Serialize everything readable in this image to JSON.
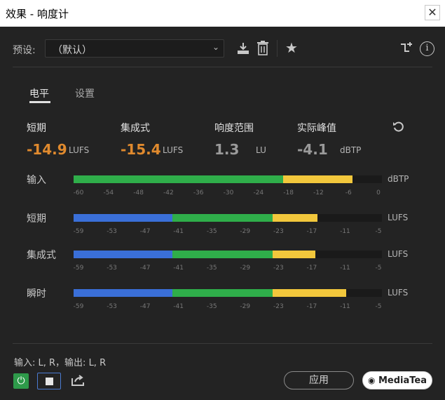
{
  "window": {
    "title": "效果 - 响度计",
    "close_glyph": "✕"
  },
  "preset": {
    "label": "预设:",
    "value": "（默认）"
  },
  "tabs": [
    {
      "label": "电平"
    },
    {
      "label": "设置"
    }
  ],
  "stats": [
    {
      "label": "短期",
      "value": "-14.9",
      "unit": "LUFS",
      "color": "#e08a2e"
    },
    {
      "label": "集成式",
      "value": "-15.4",
      "unit": "LUFS",
      "color": "#e08a2e"
    },
    {
      "label": "响度范围",
      "value": "1.3",
      "unit": "LU",
      "color": "#9a9a9a"
    },
    {
      "label": "实际峰值",
      "value": "-4.1",
      "unit": "dBTP",
      "color": "#9a9a9a"
    }
  ],
  "meters": [
    {
      "label": "输入",
      "unit": "dBTP",
      "ticks": [
        "-60",
        "-54",
        "-48",
        "-42",
        "-36",
        "-30",
        "-24",
        "-18",
        "-12",
        "-6",
        "0"
      ],
      "fill_fraction": 0.905,
      "colors": [
        "#2fae4a",
        "#f2c73c"
      ]
    },
    {
      "label": "短期",
      "unit": "LUFS",
      "ticks": [
        "-59",
        "-53",
        "-47",
        "-41",
        "-35",
        "-29",
        "-23",
        "-17",
        "-11",
        "-5"
      ],
      "fill_fraction": 0.79,
      "colors": [
        "#3a6fd8",
        "#2fae4a",
        "#f2c73c"
      ]
    },
    {
      "label": "集成式",
      "unit": "LUFS",
      "ticks": [
        "-59",
        "-53",
        "-47",
        "-41",
        "-35",
        "-29",
        "-23",
        "-17",
        "-11",
        "-5"
      ],
      "fill_fraction": 0.785,
      "colors": [
        "#3a6fd8",
        "#2fae4a",
        "#f2c73c"
      ]
    },
    {
      "label": "瞬时",
      "unit": "LUFS",
      "ticks": [
        "-59",
        "-53",
        "-47",
        "-41",
        "-35",
        "-29",
        "-23",
        "-17",
        "-11",
        "-5"
      ],
      "fill_fraction": 0.885,
      "colors": [
        "#3a6fd8",
        "#2fae4a",
        "#f2c73c"
      ]
    }
  ],
  "footer": {
    "io": "输入: L, R，输出: L, R",
    "apply": "应用",
    "watermark": "MediaTea"
  }
}
